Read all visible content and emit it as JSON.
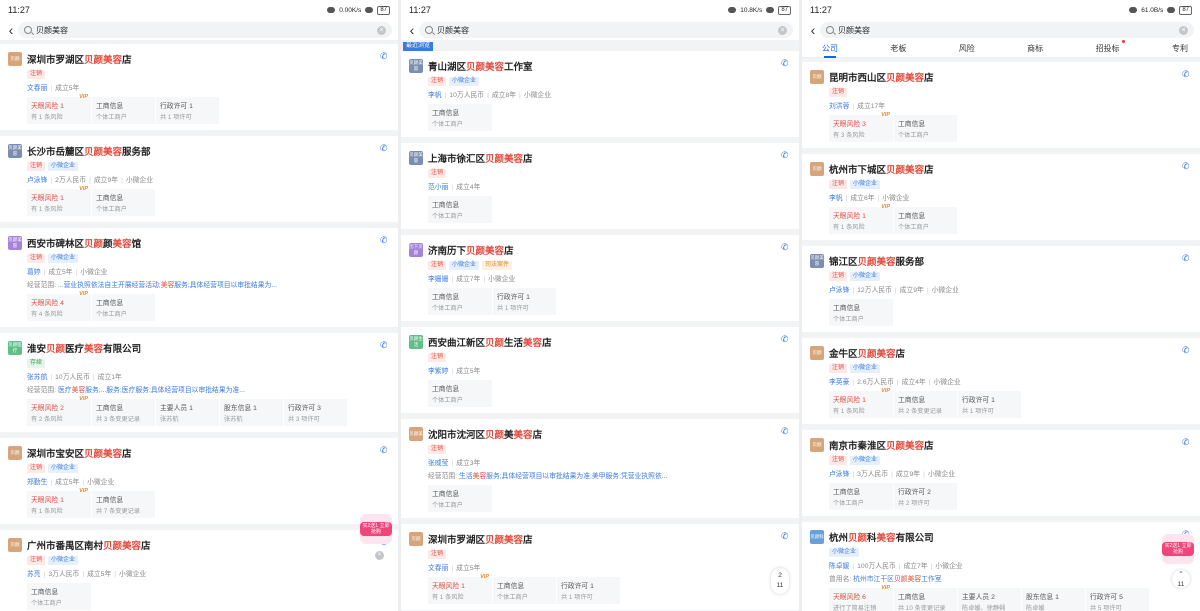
{
  "status": {
    "time": "11:27"
  },
  "screens": [
    {
      "speed": "0.00K/s",
      "battery": "87",
      "query": "贝颜美容",
      "tabs": [],
      "recent_label": "",
      "cards": [
        {
          "logo": "贝颜",
          "logo_color": "#d7a57c",
          "pre": "深圳市罗湖区",
          "hl": "贝颜美容",
          "post": "店",
          "tags": [
            {
              "text": "注销",
              "kind": "red"
            }
          ],
          "meta": [
            {
              "text": "文春丽",
              "person": true
            },
            {
              "text": "成立5年"
            }
          ],
          "scope": null,
          "boxes": [
            {
              "t": "天眼风险 1",
              "s": "有 1 条风险",
              "risk": true,
              "vip": "VIP"
            },
            {
              "t": "工商信息",
              "s": "个体工商户"
            },
            {
              "t": "行政许可 1",
              "s": "共 1 项许可"
            }
          ]
        },
        {
          "logo": "贝颜美容",
          "logo_color": "#7b8db0",
          "pre": "长沙市岳麓区",
          "hl": "贝颜美容",
          "post": "服务部",
          "tags": [
            {
              "text": "注销",
              "kind": "red"
            },
            {
              "text": "小微企业",
              "kind": "blue"
            }
          ],
          "meta": [
            {
              "text": "卢泳锋",
              "person": true
            },
            {
              "text": "2万人民币"
            },
            {
              "text": "成立9年"
            },
            {
              "text": "小微企业"
            }
          ],
          "scope": null,
          "boxes": [
            {
              "t": "天眼风险 1",
              "s": "有 1 条风险",
              "risk": true,
              "vip": "VIP"
            },
            {
              "t": "工商信息",
              "s": "个体工商户"
            }
          ]
        },
        {
          "logo": "贝颜美容",
          "logo_color": "#a583d6",
          "pre": "西安市碑林区",
          "hl": "贝颜",
          "mid": "颜",
          "hl2": "美容",
          "post": "馆",
          "tags": [
            {
              "text": "注销",
              "kind": "red"
            },
            {
              "text": "小微企业",
              "kind": "blue"
            }
          ],
          "meta": [
            {
              "text": "葛婷",
              "person": true
            },
            {
              "text": "成立5年"
            },
            {
              "text": "小微企业"
            }
          ],
          "scope": {
            "label": "经营范围:",
            "pre": "...营业执照依法自主开展经营活动;",
            "hl": "美容",
            "post": "服务;具体经营项目以审批结果为..."
          },
          "boxes": [
            {
              "t": "天眼风险 4",
              "s": "有 4 条风险",
              "risk": true,
              "vip": "VIP"
            },
            {
              "t": "工商信息",
              "s": "个体工商户"
            }
          ]
        },
        {
          "logo": "贝颜医疗",
          "logo_color": "#5fbf86",
          "pre": "淮安",
          "hl": "贝颜",
          "mid": "医疗",
          "hl2": "美容",
          "post": "有限公司",
          "tags": [
            {
              "text": "存续",
              "kind": "green"
            }
          ],
          "meta": [
            {
              "text": "张苏航",
              "person": true
            },
            {
              "text": "10万人民币"
            },
            {
              "text": "成立1年"
            }
          ],
          "scope": {
            "label": "经营范围:",
            "pre": "医疗",
            "hl": "美容",
            "post": "服务;...服务;医疗服务;具体经营项目以审批结果为准..."
          },
          "boxes": [
            {
              "t": "天眼风险 2",
              "s": "有 2 条风险",
              "risk": true,
              "vip": "VIP"
            },
            {
              "t": "工商信息",
              "s": "共 3 条变更记录"
            },
            {
              "t": "主要人员 1",
              "s": "张苏航"
            },
            {
              "t": "股东信息 1",
              "s": "张苏航"
            },
            {
              "t": "行政许可 3",
              "s": "共 3 项许可"
            }
          ]
        },
        {
          "logo": "贝颜",
          "logo_color": "#d7a57c",
          "pre": "深圳市宝安区",
          "hl": "贝颜美容",
          "post": "店",
          "tags": [
            {
              "text": "注销",
              "kind": "red"
            },
            {
              "text": "小微企业",
              "kind": "blue"
            }
          ],
          "meta": [
            {
              "text": "郑勤生",
              "person": true
            },
            {
              "text": "成立5年"
            },
            {
              "text": "小微企业"
            }
          ],
          "scope": null,
          "boxes": [
            {
              "t": "天眼风险 1",
              "s": "有 1 条风险",
              "risk": true,
              "vip": "VIP"
            },
            {
              "t": "工商信息",
              "s": "共 7 条变更记录"
            }
          ]
        },
        {
          "logo": "贝颜",
          "logo_color": "#d7a57c",
          "pre": "广州市番禺区南村",
          "hl": "贝颜美容",
          "post": "店",
          "tags": [
            {
              "text": "注销",
              "kind": "red"
            },
            {
              "text": "小微企业",
              "kind": "blue"
            }
          ],
          "meta": [
            {
              "text": "苏亮",
              "person": true
            },
            {
              "text": "3万人民币"
            },
            {
              "text": "成立5年"
            },
            {
              "text": "小微企业"
            }
          ],
          "scope": null,
          "boxes": [
            {
              "t": "工商信息",
              "s": "个体工商户"
            }
          ]
        }
      ],
      "promo": {
        "text": "买2送1 立即抢购"
      }
    },
    {
      "speed": "10.8K/s",
      "battery": "87",
      "query": "贝颜美容",
      "tabs": [],
      "recent_label": "最近浏览",
      "cards": [
        {
          "logo": "贝颜美容",
          "logo_color": "#7b8db0",
          "pre": "青山湖区",
          "hl": "贝颜美容",
          "post": "工作室",
          "tags": [
            {
              "text": "注销",
              "kind": "red"
            },
            {
              "text": "小微企业",
              "kind": "blue"
            }
          ],
          "meta": [
            {
              "text": "李帆",
              "person": true
            },
            {
              "text": "10万人民币"
            },
            {
              "text": "成立8年"
            },
            {
              "text": "小微企业"
            }
          ],
          "scope": null,
          "boxes": [
            {
              "t": "工商信息",
              "s": "个体工商户"
            }
          ]
        },
        {
          "logo": "贝颜美容",
          "logo_color": "#7b8db0",
          "pre": "上海市徐汇区",
          "hl": "贝颜美容",
          "post": "店",
          "tags": [
            {
              "text": "注销",
              "kind": "red"
            }
          ],
          "meta": [
            {
              "text": "范小丽",
              "person": true
            },
            {
              "text": "成立4年"
            }
          ],
          "scope": null,
          "boxes": [
            {
              "t": "工商信息",
              "s": "个体工商户"
            }
          ]
        },
        {
          "logo": "历下贝颜",
          "logo_color": "#a583d6",
          "pre": "济南历下",
          "hl": "贝颜美容",
          "post": "店",
          "tags": [
            {
              "text": "注销",
              "kind": "red"
            },
            {
              "text": "小微企业",
              "kind": "blue"
            },
            {
              "text": "司法案件",
              "kind": "orange"
            }
          ],
          "meta": [
            {
              "text": "李姗姗",
              "person": true
            },
            {
              "text": "成立7年"
            },
            {
              "text": "小微企业"
            }
          ],
          "scope": null,
          "boxes": [
            {
              "t": "工商信息",
              "s": "个体工商户"
            },
            {
              "t": "行政许可 1",
              "s": "共 1 项许可"
            }
          ]
        },
        {
          "logo": "贝颜生活",
          "logo_color": "#5fbf86",
          "pre": "西安曲江新区",
          "hl": "贝颜",
          "mid": "生活",
          "hl2": "美容",
          "post": "店",
          "tags": [
            {
              "text": "注销",
              "kind": "red"
            }
          ],
          "meta": [
            {
              "text": "李紫婷",
              "person": true
            },
            {
              "text": "成立5年"
            }
          ],
          "scope": null,
          "boxes": [
            {
              "t": "工商信息",
              "s": "个体工商户"
            }
          ]
        },
        {
          "logo": "贝颜美",
          "logo_color": "#d7a57c",
          "pre": "沈阳市沈河区",
          "hl": "贝颜",
          "mid": "美",
          "hl2": "美容",
          "post": "店",
          "tags": [
            {
              "text": "注销",
              "kind": "red"
            }
          ],
          "meta": [
            {
              "text": "张威莹",
              "person": true
            },
            {
              "text": "成立3年"
            }
          ],
          "scope": {
            "label": "经营范围:",
            "pre": "生活",
            "hl": "美容",
            "post": "服务;具体经营项目以审批结果为准;美甲服务;凭营业执照依..."
          },
          "boxes": [
            {
              "t": "工商信息",
              "s": "个体工商户"
            }
          ]
        },
        {
          "logo": "贝颜",
          "logo_color": "#d7a57c",
          "pre": "深圳市罗湖区",
          "hl": "贝颜美容",
          "post": "店",
          "tags": [
            {
              "text": "注销",
              "kind": "red"
            }
          ],
          "meta": [
            {
              "text": "文春丽",
              "person": true
            },
            {
              "text": "成立5年"
            }
          ],
          "scope": null,
          "boxes": [
            {
              "t": "天眼风险 1",
              "s": "有 1 条风险",
              "risk": true,
              "vip": "VIP"
            },
            {
              "t": "工商信息",
              "s": "个体工商户"
            },
            {
              "t": "行政许可 1",
              "s": "共 1 项许可"
            }
          ]
        }
      ],
      "pager": {
        "top": "2",
        "bottom": "11"
      }
    },
    {
      "speed": "61.0B/s",
      "battery": "87",
      "query": "贝颜美容",
      "tabs": [
        {
          "label": "公司",
          "active": true
        },
        {
          "label": "老板"
        },
        {
          "label": "风险"
        },
        {
          "label": "商标"
        },
        {
          "label": "招投标",
          "dot": true
        },
        {
          "label": "专利"
        }
      ],
      "recent_label": "",
      "cards": [
        {
          "logo": "贝颜",
          "logo_color": "#d7a57c",
          "pre": "昆明市西山区",
          "hl": "贝颜美容",
          "post": "店",
          "tags": [
            {
              "text": "注销",
              "kind": "red"
            }
          ],
          "meta": [
            {
              "text": "刘洪蓉",
              "person": true
            },
            {
              "text": "成立17年"
            }
          ],
          "scope": null,
          "boxes": [
            {
              "t": "天眼风险 3",
              "s": "有 3 条风险",
              "risk": true,
              "vip": "VIP"
            },
            {
              "t": "工商信息",
              "s": "个体工商户"
            }
          ]
        },
        {
          "logo": "贝颜",
          "logo_color": "#d7a57c",
          "pre": "杭州市下城区",
          "hl": "贝颜美容",
          "post": "店",
          "tags": [
            {
              "text": "注销",
              "kind": "red"
            },
            {
              "text": "小微企业",
              "kind": "blue"
            }
          ],
          "meta": [
            {
              "text": "李帆",
              "person": true
            },
            {
              "text": "成立6年"
            },
            {
              "text": "小微企业"
            }
          ],
          "scope": null,
          "boxes": [
            {
              "t": "天眼风险 1",
              "s": "有 1 条风险",
              "risk": true,
              "vip": "VIP"
            },
            {
              "t": "工商信息",
              "s": "个体工商户"
            }
          ]
        },
        {
          "logo": "贝颜美容",
          "logo_color": "#7b8db0",
          "pre": "锦江区",
          "hl": "贝颜美容",
          "post": "服务部",
          "tags": [
            {
              "text": "注销",
              "kind": "red"
            },
            {
              "text": "小微企业",
              "kind": "blue"
            }
          ],
          "meta": [
            {
              "text": "卢泳锋",
              "person": true
            },
            {
              "text": "12万人民币"
            },
            {
              "text": "成立9年"
            },
            {
              "text": "小微企业"
            }
          ],
          "scope": null,
          "boxes": [
            {
              "t": "工商信息",
              "s": "个体工商户"
            }
          ]
        },
        {
          "logo": "贝颜",
          "logo_color": "#d7a57c",
          "pre": "金牛区",
          "hl": "贝颜美容",
          "post": "店",
          "tags": [
            {
              "text": "注销",
              "kind": "red"
            },
            {
              "text": "小微企业",
              "kind": "blue"
            }
          ],
          "meta": [
            {
              "text": "李英豪",
              "person": true
            },
            {
              "text": "2.6万人民币"
            },
            {
              "text": "成立4年"
            },
            {
              "text": "小微企业"
            }
          ],
          "scope": null,
          "boxes": [
            {
              "t": "天眼风险 1",
              "s": "有 1 条风险",
              "risk": true,
              "vip": "VIP"
            },
            {
              "t": "工商信息",
              "s": "共 2 条变更记录"
            },
            {
              "t": "行政许可 1",
              "s": "共 1 项许可"
            }
          ]
        },
        {
          "logo": "贝颜",
          "logo_color": "#d7a57c",
          "pre": "南京市秦淮区",
          "hl": "贝颜美容",
          "post": "店",
          "tags": [
            {
              "text": "注销",
              "kind": "red"
            },
            {
              "text": "小微企业",
              "kind": "blue"
            }
          ],
          "meta": [
            {
              "text": "卢泳锋",
              "person": true
            },
            {
              "text": "3万人民币"
            },
            {
              "text": "成立9年"
            },
            {
              "text": "小微企业"
            }
          ],
          "scope": null,
          "boxes": [
            {
              "t": "工商信息",
              "s": "个体工商户"
            },
            {
              "t": "行政许可 2",
              "s": "共 2 项许可"
            }
          ]
        },
        {
          "logo": "贝颜科",
          "logo_color": "#6aa0d8",
          "pre": "杭州",
          "hl": "贝颜",
          "mid": "科",
          "hl2": "美容",
          "post": "有限公司",
          "tags": [
            {
              "text": "小微企业",
              "kind": "blue"
            }
          ],
          "meta": [
            {
              "text": "陈卓媛",
              "person": true
            },
            {
              "text": "100万人民币"
            },
            {
              "text": "成立7年"
            },
            {
              "text": "小微企业"
            }
          ],
          "scope": {
            "label": "曾用名:",
            "pre": "杭州市江干区",
            "hl": "贝颜美容",
            "post": "工作室"
          },
          "boxes": [
            {
              "t": "天眼风险 6",
              "s": "进行了简易注销",
              "risk": true,
              "vip": "VIP"
            },
            {
              "t": "工商信息",
              "s": "共 10 条变更记录"
            },
            {
              "t": "主要人员 2",
              "s": "陈卓媛、徐静娴"
            },
            {
              "t": "股东信息 1",
              "s": "陈卓媛"
            },
            {
              "t": "行政许可 5",
              "s": "共 5 项许可"
            }
          ]
        }
      ],
      "promo": {
        "text": "买2送1 立即抢购"
      },
      "pager": {
        "top": "",
        "bottom": "11"
      }
    }
  ]
}
